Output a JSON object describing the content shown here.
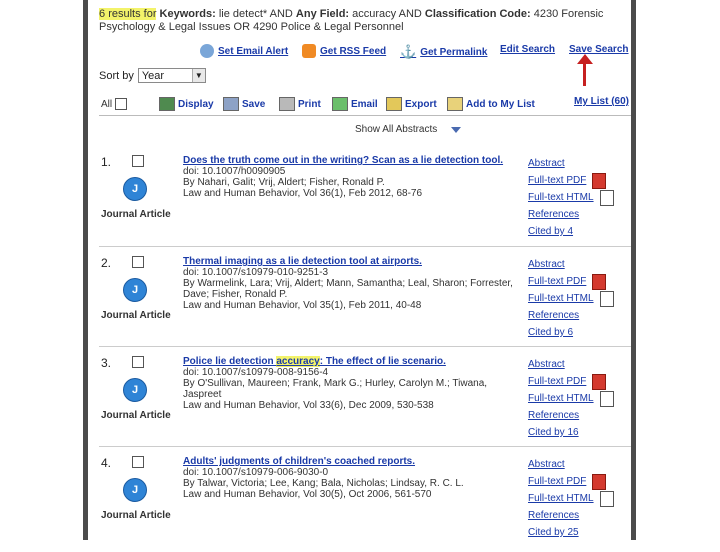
{
  "summary": {
    "count": "6",
    "prefix": "results for",
    "kw_label": "Keywords:",
    "kw_value": "lie detect* AND",
    "field_label": "Any Field:",
    "field_value": "accuracy AND",
    "class_label": "Classification Code:",
    "class_value": "4230 Forensic Psychology & Legal Issues OR 4290 Police & Legal Personnel"
  },
  "toolbar": {
    "email_alert": "Set Email Alert",
    "rss": "Get RSS Feed",
    "permalink": "Get Permalink",
    "edit_search": "Edit Search",
    "save_search": "Save Search"
  },
  "sort": {
    "label": "Sort by",
    "value": "Year"
  },
  "actions": {
    "all_label": "All",
    "display": "Display",
    "save": "Save",
    "print": "Print",
    "email": "Email",
    "export": "Export",
    "add_to_list": "Add to My List",
    "my_list": "My List (60)"
  },
  "show_all": "Show All Abstracts",
  "results": [
    {
      "num": "1.",
      "type": "Journal Article",
      "title": "Does the truth come out in the writing? Scan as a lie detection tool.",
      "doi": "doi: 10.1007/h0090905",
      "authors": "By Nahari, Galit; Vrij, Aldert; Fisher, Ronald P.",
      "source": "Law and Human Behavior, Vol 36(1), Feb 2012, 68-76",
      "cited": "Cited by 4"
    },
    {
      "num": "2.",
      "type": "Journal Article",
      "title": "Thermal imaging as a lie detection tool at airports.",
      "doi": "doi: 10.1007/s10979-010-9251-3",
      "authors": "By Warmelink, Lara; Vrij, Aldert; Mann, Samantha; Leal, Sharon; Forrester, Dave; Fisher, Ronald P.",
      "source": "Law and Human Behavior, Vol 35(1), Feb 2011, 40-48",
      "cited": "Cited by 6"
    },
    {
      "num": "3.",
      "type": "Journal Article",
      "title_before": "Police lie detection ",
      "title_hl": "accuracy",
      "title_after": ": The effect of lie scenario.",
      "doi": "doi: 10.1007/s10979-008-9156-4",
      "authors": "By O'Sullivan, Maureen; Frank, Mark G.; Hurley, Carolyn M.; Tiwana, Jaspreet",
      "source": "Law and Human Behavior, Vol 33(6), Dec 2009, 530-538",
      "cited": "Cited by 16"
    },
    {
      "num": "4.",
      "type": "Journal Article",
      "title": "Adults' judgments of children's coached reports.",
      "doi": "doi: 10.1007/s10979-006-9030-0",
      "authors": "By Talwar, Victoria; Lee, Kang; Bala, Nicholas; Lindsay, R. C. L.",
      "source": "Law and Human Behavior, Vol 30(5), Oct 2006, 561-570",
      "cited": "Cited by 25"
    }
  ],
  "links": {
    "abstract": "Abstract",
    "pdf": "Full-text PDF",
    "html": "Full-text HTML",
    "refs": "References"
  },
  "icons": {
    "email_alert": "email-alert-icon",
    "rss": "rss-icon",
    "permalink": "anchor-icon"
  }
}
